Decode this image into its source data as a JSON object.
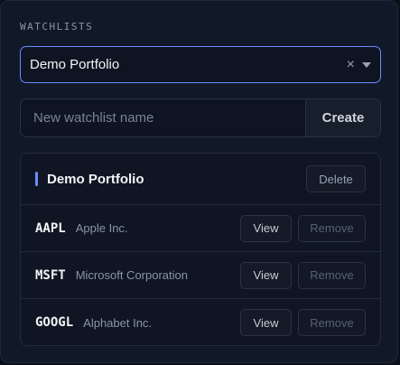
{
  "section": {
    "title": "WATCHLISTS"
  },
  "select": {
    "value": "Demo Portfolio",
    "clear_glyph": "×"
  },
  "create": {
    "placeholder": "New watchlist name",
    "button_label": "Create"
  },
  "watchlist": {
    "title": "Demo Portfolio",
    "delete_label": "Delete",
    "items": [
      {
        "ticker": "AAPL",
        "name": "Apple Inc.",
        "view_label": "View",
        "remove_label": "Remove"
      },
      {
        "ticker": "MSFT",
        "name": "Microsoft Corporation",
        "view_label": "View",
        "remove_label": "Remove"
      },
      {
        "ticker": "GOOGL",
        "name": "Alphabet Inc.",
        "view_label": "View",
        "remove_label": "Remove"
      }
    ]
  },
  "colors": {
    "accent": "#6b8cff",
    "background": "#111827"
  }
}
